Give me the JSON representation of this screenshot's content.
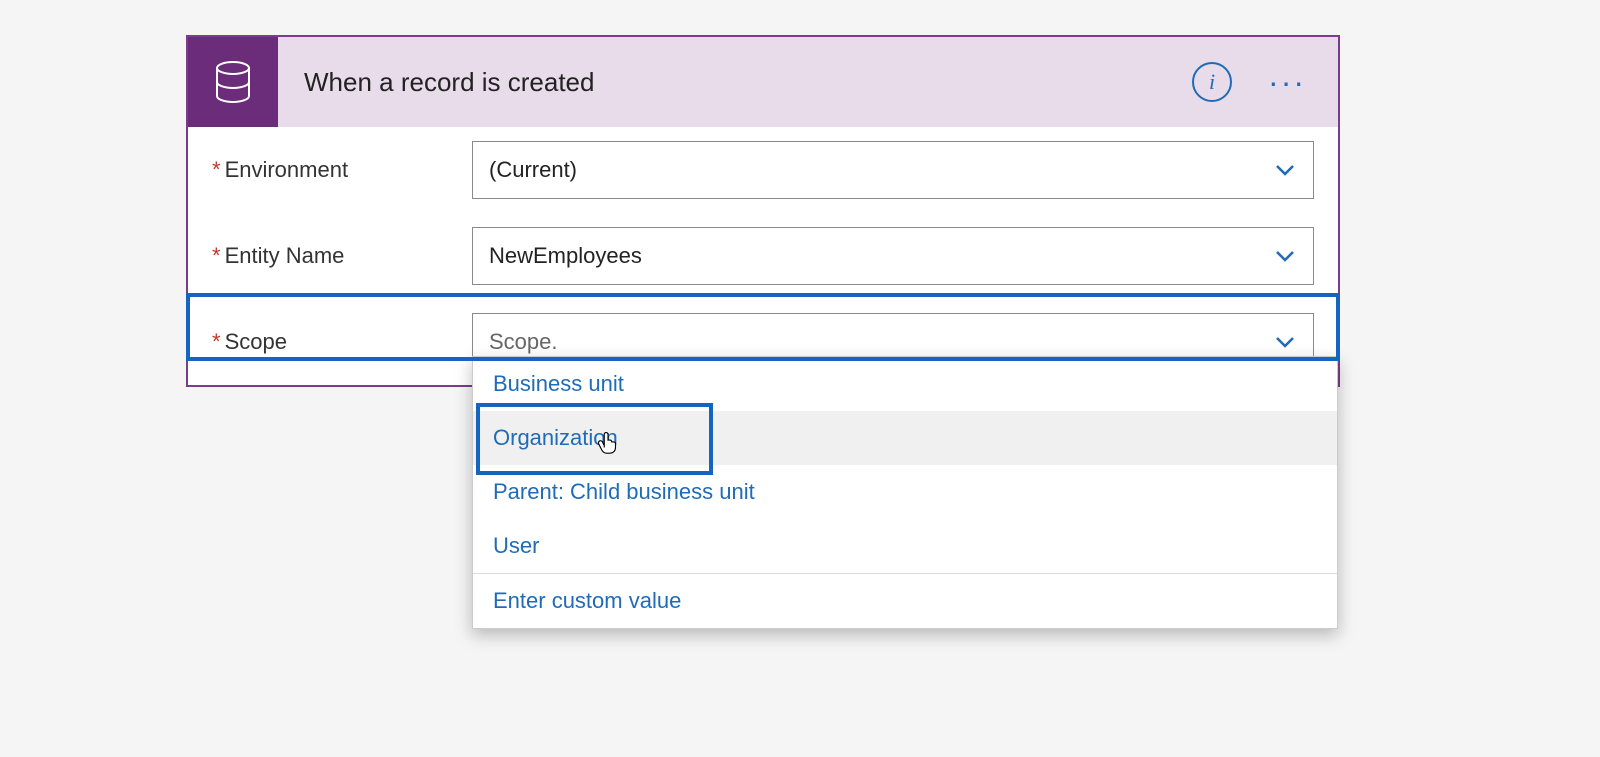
{
  "card": {
    "title": "When a record is created",
    "fields": {
      "environment": {
        "label": "Environment",
        "required": true,
        "value": "(Current)"
      },
      "entity": {
        "label": "Entity Name",
        "required": true,
        "value": "NewEmployees"
      },
      "scope": {
        "label": "Scope",
        "required": true,
        "placeholder": "Scope."
      }
    }
  },
  "dropdown": {
    "items": [
      "Business unit",
      "Organization",
      "Parent: Child business unit",
      "User"
    ],
    "custom": "Enter custom value"
  }
}
